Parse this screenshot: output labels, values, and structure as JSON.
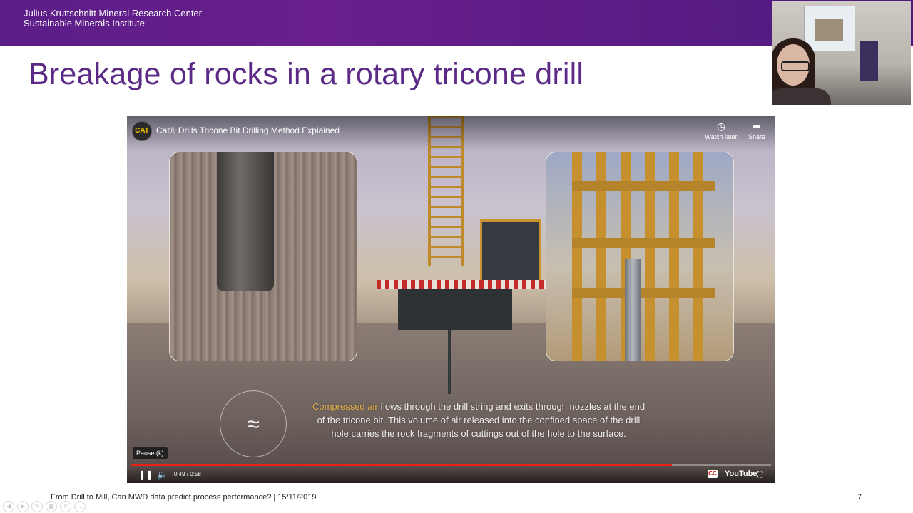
{
  "header": {
    "org_line1": "Julius Kruttschnitt Mineral Research Center",
    "org_line2": "Sustainable Minerals Institute",
    "brand_color": "#5b1d88"
  },
  "slide": {
    "title": "Breakage of rocks in a rotary tricone drill",
    "title_color": "#5b2a86",
    "footer": "From Drill to Mill, Can MWD data predict process performance? | 15/11/2019",
    "page_number": "7"
  },
  "video": {
    "channel_logo": "CAT",
    "title": "Cat® Drills Tricone Bit Drilling Method Explained",
    "watch_later_label": "Watch later",
    "share_label": "Share",
    "caption_highlight": "Compressed air",
    "caption_line1_rest": " flows through the drill string and exits through nozzles at the end",
    "caption_line2": "of the tricone bit. This volume of air released into the confined space of the drill",
    "caption_line3": "hole carries the rock fragments of cuttings out of the hole to the surface.",
    "tooltip": "Pause (k)",
    "time": "0:49 / 0:58",
    "progress_fraction": 0.845,
    "brand_logo": "YouTube",
    "cc_label": "CC",
    "progress_color": "#e62117"
  },
  "icons": {
    "watch_later": "clock-icon",
    "share": "share-arrow-icon",
    "pause": "pause-icon",
    "volume": "volume-icon",
    "fullscreen": "fullscreen-icon",
    "emblem": "air-swirl-icon"
  }
}
